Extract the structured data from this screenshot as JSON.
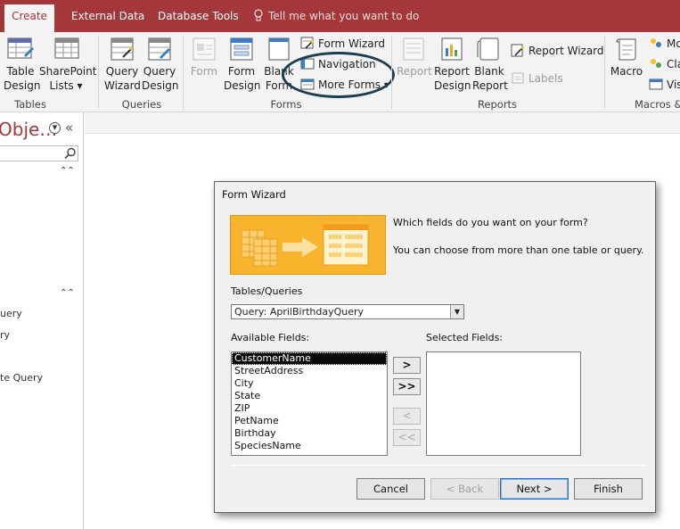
{
  "tabs": {
    "create": "Create",
    "external_data": "External Data",
    "database_tools": "Database Tools"
  },
  "tell_me": "Tell me what you want to do",
  "ribbon": {
    "tables": {
      "table_design": [
        "Table",
        "Design"
      ],
      "sharepoint_lists": [
        "SharePoint",
        "Lists ▾"
      ],
      "label": "Tables"
    },
    "queries": {
      "query_wizard": [
        "Query",
        "Wizard"
      ],
      "query_design": [
        "Query",
        "Design"
      ],
      "label": "Queries"
    },
    "forms": {
      "form": "Form",
      "form_design": [
        "Form",
        "Design"
      ],
      "blank_form": [
        "Blank",
        "Form"
      ],
      "form_wizard": "Form Wizard",
      "navigation": "Navigation",
      "more_forms": "More Forms ▾",
      "label": "Forms"
    },
    "reports": {
      "report": "Report",
      "report_design": [
        "Report",
        "Design"
      ],
      "blank_report": [
        "Blank",
        "Report"
      ],
      "report_wizard": "Report Wizard",
      "labels": "Labels",
      "label": "Reports"
    },
    "macros": {
      "macro": "Macro",
      "module": "Mo",
      "class_module": "Cla",
      "visual_basic": "Visu",
      "label": "Macros &"
    }
  },
  "nav_pane": {
    "title": "Obje…",
    "items": [
      "uery",
      "ry",
      "te Query"
    ]
  },
  "dialog": {
    "title": "Form Wizard",
    "prompt": "Which fields do you want on your form?",
    "prompt2": "You can choose from more than one table or query.",
    "tables_queries_label": "Tables/Queries",
    "tables_queries_value": "Query: AprilBirthdayQuery",
    "available_label": "Available Fields:",
    "selected_label": "Selected Fields:",
    "available_fields": [
      "CustomerName",
      "StreetAddress",
      "City",
      "State",
      "ZIP",
      "PetName",
      "Birthday",
      "SpeciesName"
    ],
    "selected_index": 0,
    "move_one": ">",
    "move_all": ">>",
    "remove_one": "<",
    "remove_all": "<<",
    "cancel": "Cancel",
    "back": "< Back",
    "next": "Next >",
    "finish": "Finish"
  },
  "colors": {
    "accent": "#a4373a",
    "banner": "#f7b42c",
    "ellipse": "#1d3e52"
  }
}
